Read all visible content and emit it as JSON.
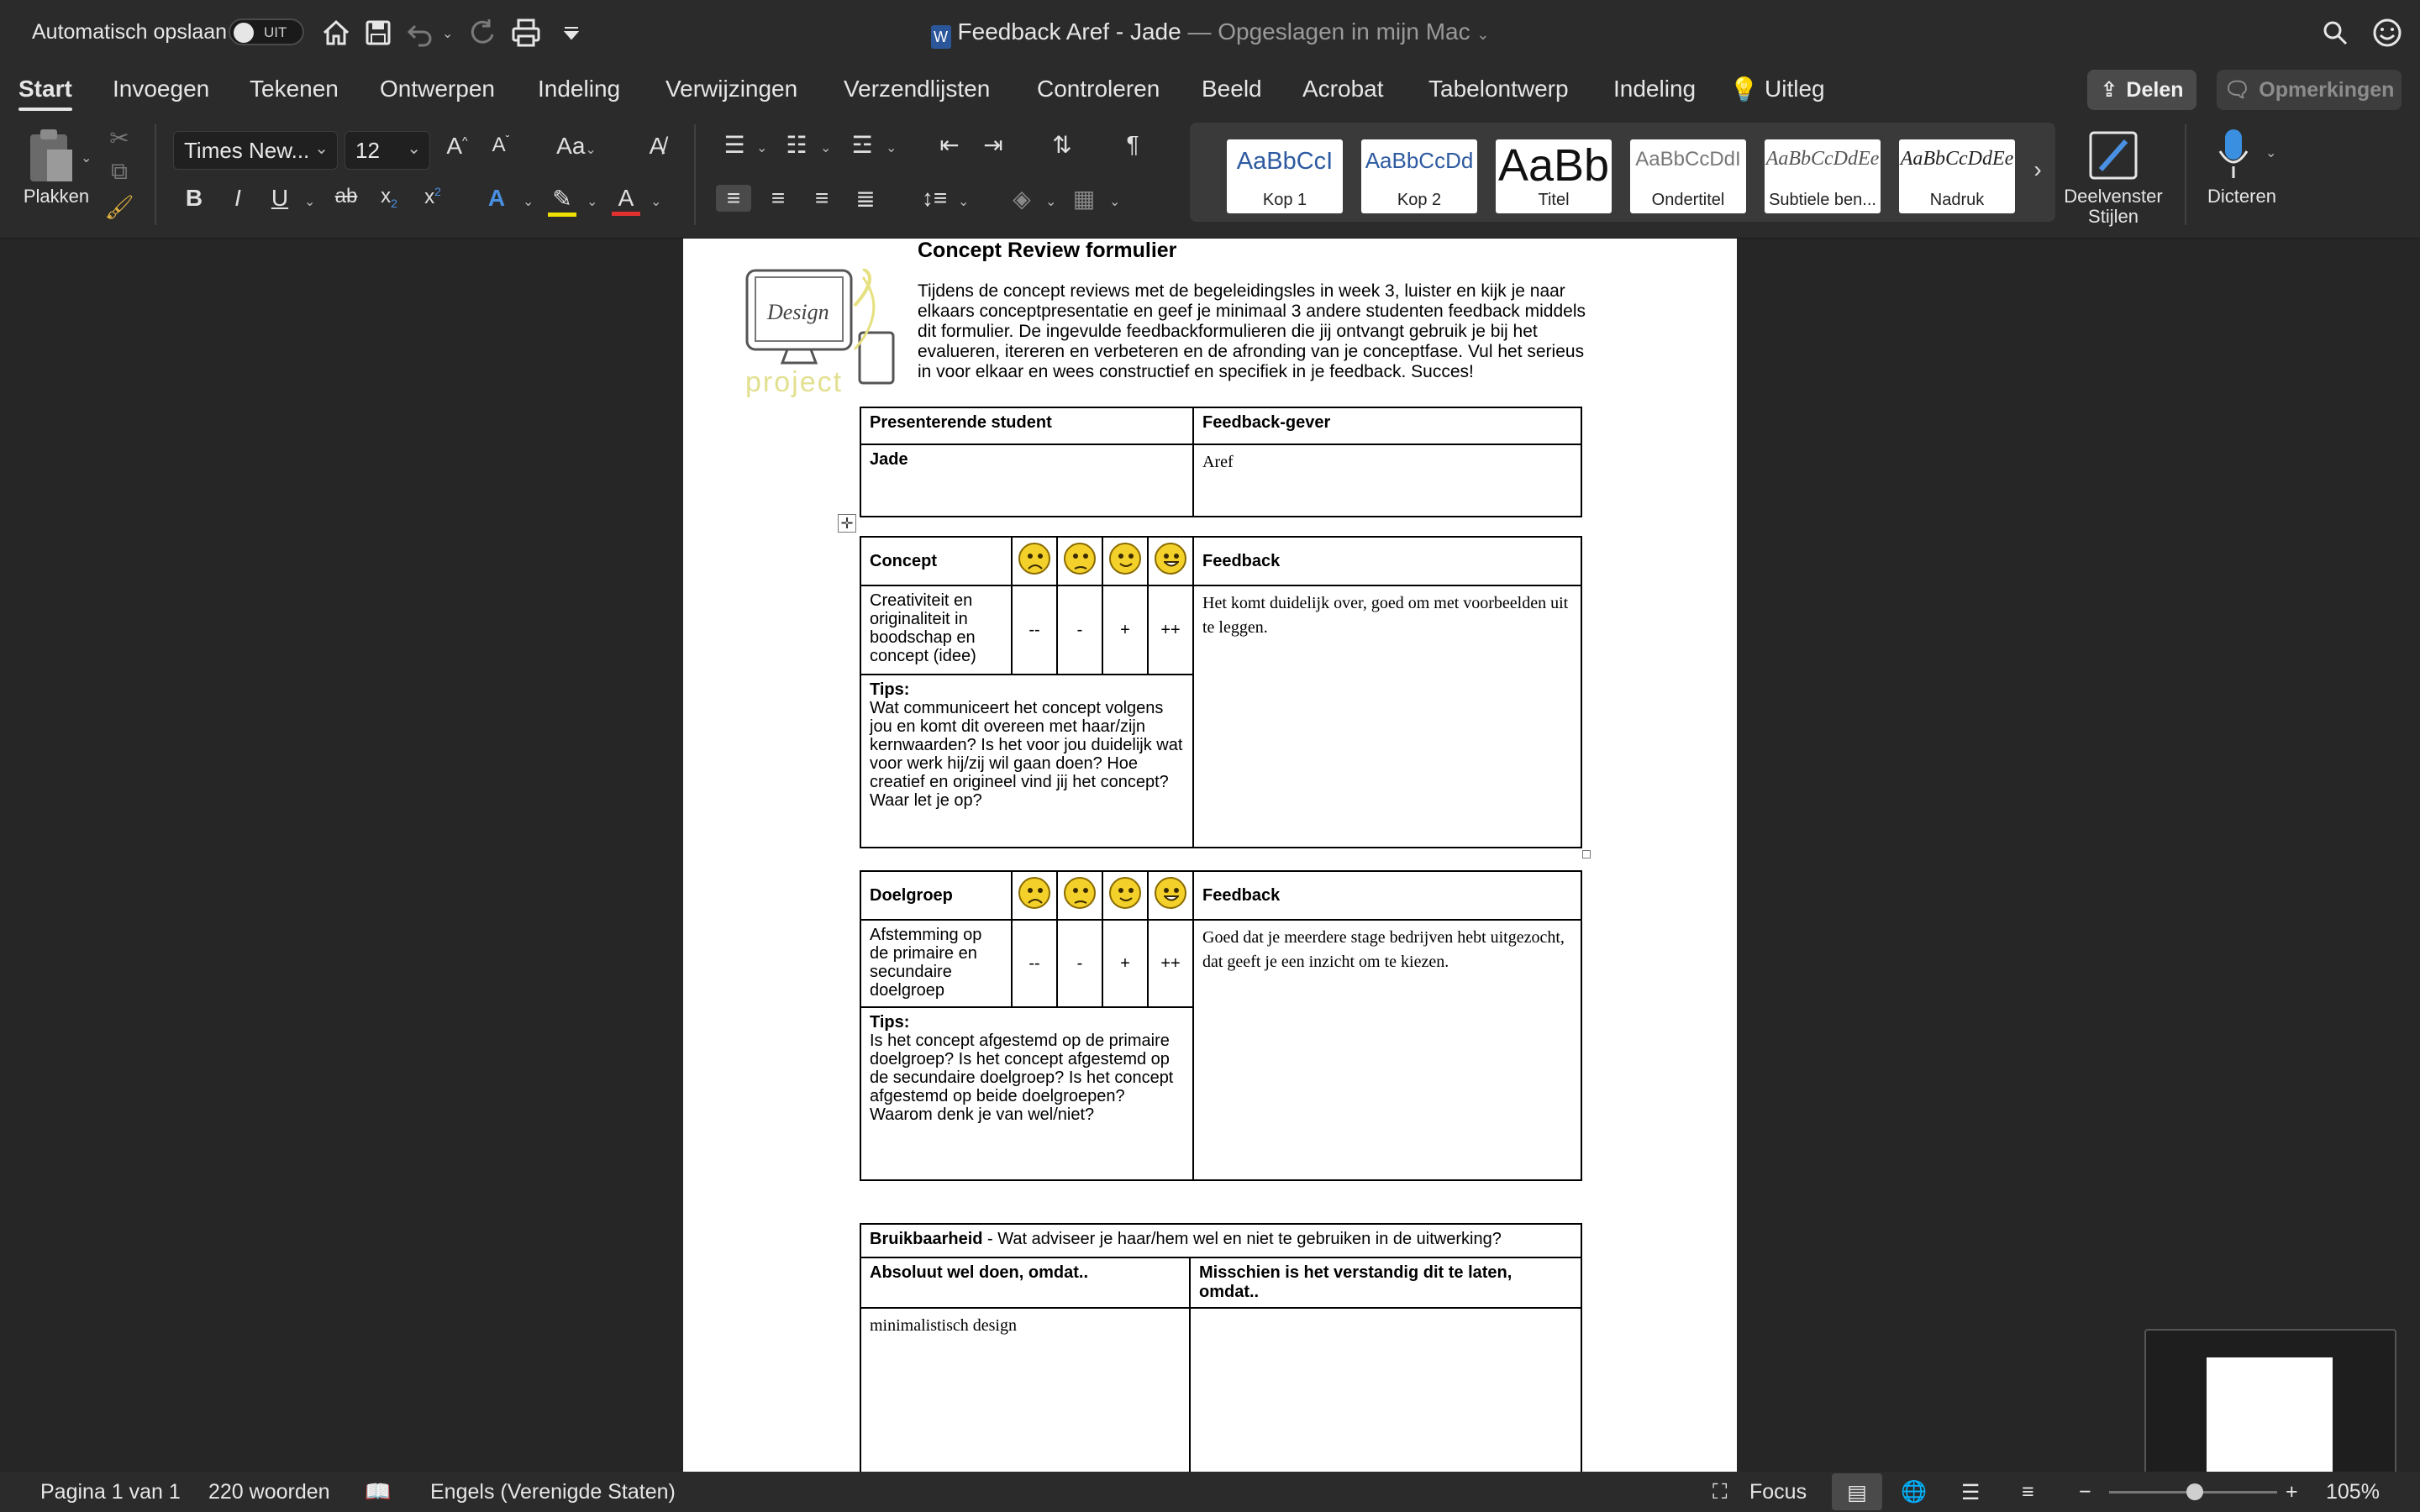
{
  "titlebar": {
    "autosave_label": "Automatisch opslaan",
    "autosave_state": "UIT",
    "doc_name": "Feedback Aref - Jade",
    "save_location": "— Opgeslagen in mijn Mac"
  },
  "tabs": [
    "Start",
    "Invoegen",
    "Tekenen",
    "Ontwerpen",
    "Indeling",
    "Verwijzingen",
    "Verzendlijsten",
    "Controleren",
    "Beeld",
    "Acrobat",
    "Tabelontwerp",
    "Indeling",
    "Uitleg"
  ],
  "share_label": "Delen",
  "comments_label": "Opmerkingen",
  "ribbon": {
    "paste_label": "Plakken",
    "font_name": "Times New...",
    "font_size": "12",
    "styles": [
      {
        "sample": "AaBbCcI",
        "label": "Kop 1"
      },
      {
        "sample": "AaBbCcDd",
        "label": "Kop 2"
      },
      {
        "sample": "AaBb",
        "label": "Titel"
      },
      {
        "sample": "AaBbCcDdI",
        "label": "Ondertitel"
      },
      {
        "sample": "AaBbCcDdEe",
        "label": "Subtiele ben..."
      },
      {
        "sample": "AaBbCcDdEe",
        "label": "Nadruk"
      }
    ],
    "styles_pane_label": "Deelvenster Stijlen",
    "dictate_label": "Dicteren"
  },
  "document": {
    "form_title": "Concept Review formulier",
    "intro": "Tijdens de concept reviews met de begeleidingsles in week 3, luister en kijk je naar elkaars conceptpresentatie en geef je minimaal 3 andere studenten feedback middels dit formulier. De ingevulde feedbackformulieren die jij ontvangt gebruik je bij het evalueren, itereren en verbeteren en de afronding van je conceptfase. Vul het serieus in voor elkaar en wees constructief en specifiek in je feedback. Succes!",
    "logo_text": "project",
    "people": {
      "presenter_header": "Presenterende student",
      "giver_header": "Feedback-gever",
      "presenter": "Jade",
      "giver": "Aref"
    },
    "concept": {
      "header": "Concept",
      "feedback_header": "Feedback",
      "criterion": "Creativiteit en originaliteit in boodschap en concept (idee)",
      "scale": [
        "--",
        "-",
        "+",
        "++"
      ],
      "tips_label": "Tips:",
      "tips": "Wat communiceert het concept volgens jou en komt dit overeen met haar/zijn kernwaarden? Is het voor jou duidelijk wat voor werk hij/zij wil gaan doen? Hoe creatief en origineel vind jij het concept? Waar let je op?",
      "feedback": "Het komt duidelijk over, goed om met voorbeelden uit te leggen."
    },
    "target": {
      "header": "Doelgroep",
      "feedback_header": "Feedback",
      "criterion": "Afstemming op de primaire en secundaire doelgroep",
      "scale": [
        "--",
        "-",
        "+",
        "++"
      ],
      "tips_label": "Tips:",
      "tips": "Is het concept afgestemd op de primaire doelgroep? Is het concept afgestemd op de secundaire doelgroep? Is het concept afgestemd op beide doelgroepen? Waarom denk je van wel/niet?",
      "feedback": "Goed dat je meerdere stage bedrijven hebt uitgezocht, dat geeft je een inzicht om te kiezen."
    },
    "usability": {
      "header_bold": "Bruikbaarheid",
      "header_rest": " - Wat adviseer je haar/hem wel en niet te gebruiken in de uitwerking?",
      "col1": "Absoluut wel doen, omdat..",
      "col2": "Misschien is het verstandig dit te laten, omdat..",
      "col1_value": "minimalistisch design",
      "col2_value": ""
    }
  },
  "status": {
    "page": "Pagina 1 van 1",
    "words": "220 woorden",
    "language": "Engels (Verenigde Staten)",
    "focus": "Focus",
    "zoom": "105%"
  }
}
